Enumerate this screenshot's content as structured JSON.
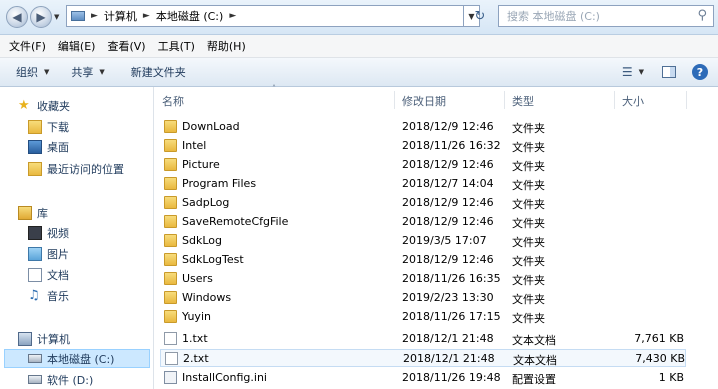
{
  "address": {
    "segments": [
      "计算机",
      "本地磁盘 (C:)"
    ],
    "search_placeholder": "搜索 本地磁盘 (C:)"
  },
  "menu": [
    "文件(F)",
    "编辑(E)",
    "查看(V)",
    "工具(T)",
    "帮助(H)"
  ],
  "toolbar": {
    "organize": "组织",
    "share": "共享",
    "new_folder": "新建文件夹"
  },
  "nav": {
    "favorites": "收藏夹",
    "downloads": "下载",
    "desktop": "桌面",
    "recent": "最近访问的位置",
    "libraries": "库",
    "videos": "视频",
    "pictures": "图片",
    "documents": "文档",
    "music": "音乐",
    "computer": "计算机",
    "local_disk_c": "本地磁盘 (C:)",
    "software_d": "软件 (D:)"
  },
  "columns": {
    "name": "名称",
    "modified": "修改日期",
    "type": "类型",
    "size": "大小"
  },
  "files": [
    {
      "name": "DownLoad",
      "modified": "2018/12/9 12:46",
      "type": "文件夹",
      "size": ""
    },
    {
      "name": "Intel",
      "modified": "2018/11/26 16:32",
      "type": "文件夹",
      "size": ""
    },
    {
      "name": "Picture",
      "modified": "2018/12/9 12:46",
      "type": "文件夹",
      "size": ""
    },
    {
      "name": "Program Files",
      "modified": "2018/12/7 14:04",
      "type": "文件夹",
      "size": ""
    },
    {
      "name": "SadpLog",
      "modified": "2018/12/9 12:46",
      "type": "文件夹",
      "size": ""
    },
    {
      "name": "SaveRemoteCfgFile",
      "modified": "2018/12/9 12:46",
      "type": "文件夹",
      "size": ""
    },
    {
      "name": "SdkLog",
      "modified": "2019/3/5 17:07",
      "type": "文件夹",
      "size": ""
    },
    {
      "name": "SdkLogTest",
      "modified": "2018/12/9 12:46",
      "type": "文件夹",
      "size": ""
    },
    {
      "name": "Users",
      "modified": "2018/11/26 16:35",
      "type": "文件夹",
      "size": ""
    },
    {
      "name": "Windows",
      "modified": "2019/2/23 13:30",
      "type": "文件夹",
      "size": ""
    },
    {
      "name": "Yuyin",
      "modified": "2018/11/26 17:15",
      "type": "文件夹",
      "size": ""
    },
    {
      "name": "1.txt",
      "modified": "2018/12/1 21:48",
      "type": "文本文档",
      "size": "7,761 KB"
    },
    {
      "name": "2.txt",
      "modified": "2018/12/1 21:48",
      "type": "文本文档",
      "size": "7,430 KB"
    },
    {
      "name": "InstallConfig.ini",
      "modified": "2018/11/26 19:48",
      "type": "配置设置",
      "size": "1 KB"
    }
  ]
}
